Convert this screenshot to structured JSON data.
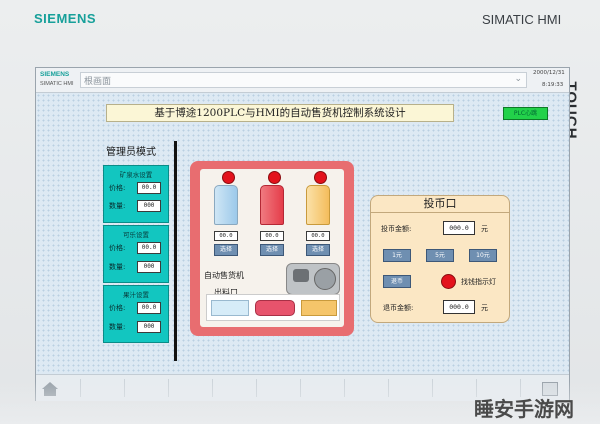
{
  "device": {
    "brand": "SIEMENS",
    "model": "SIMATIC HMI",
    "side_label": "TOUCH"
  },
  "topbar": {
    "brand": "SIEMENS",
    "model": "SIMATIC HMI",
    "screen_name": "根画面",
    "date": "2000/12/31",
    "time": "8:19:33"
  },
  "header": {
    "title": "基于博途1200PLC与HMI的自动售货机控制系统设计",
    "plc_button": "PLC心跳"
  },
  "admin": {
    "title": "管理员模式",
    "panels": [
      {
        "heading": "矿泉水设置",
        "price_label": "价格:",
        "price_value": "00.0",
        "qty_label": "数量:",
        "qty_value": "000"
      },
      {
        "heading": "可乐设置",
        "price_label": "价格:",
        "price_value": "00.0",
        "qty_label": "数量:",
        "qty_value": "000"
      },
      {
        "heading": "果汁设置",
        "price_label": "价格:",
        "price_value": "00.0",
        "qty_label": "数量:",
        "qty_value": "000"
      }
    ]
  },
  "vending": {
    "products": [
      {
        "price": "00.0",
        "select": "选择"
      },
      {
        "price": "00.0",
        "select": "选择"
      },
      {
        "price": "00.0",
        "select": "选择"
      }
    ],
    "machine_label": "自动售货机",
    "outlet_label": "出料口"
  },
  "coin": {
    "title": "投币口",
    "inserted_label": "投币金额:",
    "inserted_value": "000.0",
    "unit": "元",
    "coin_buttons": [
      "1元",
      "5元",
      "10元"
    ],
    "refund_button": "退币",
    "change_lamp_label": "找钱指示灯",
    "refund_label": "退币金额:",
    "refund_value": "000.0",
    "refund_unit": "元"
  },
  "watermark": {
    "text": "睡安手游网"
  },
  "colors": {
    "accent": "#17a09a",
    "panel": "#12c6c0",
    "machine": "#e86d70",
    "coinbox": "#fbe7c4",
    "lamp": "#e3121c",
    "heartbeat": "#22d14a"
  }
}
